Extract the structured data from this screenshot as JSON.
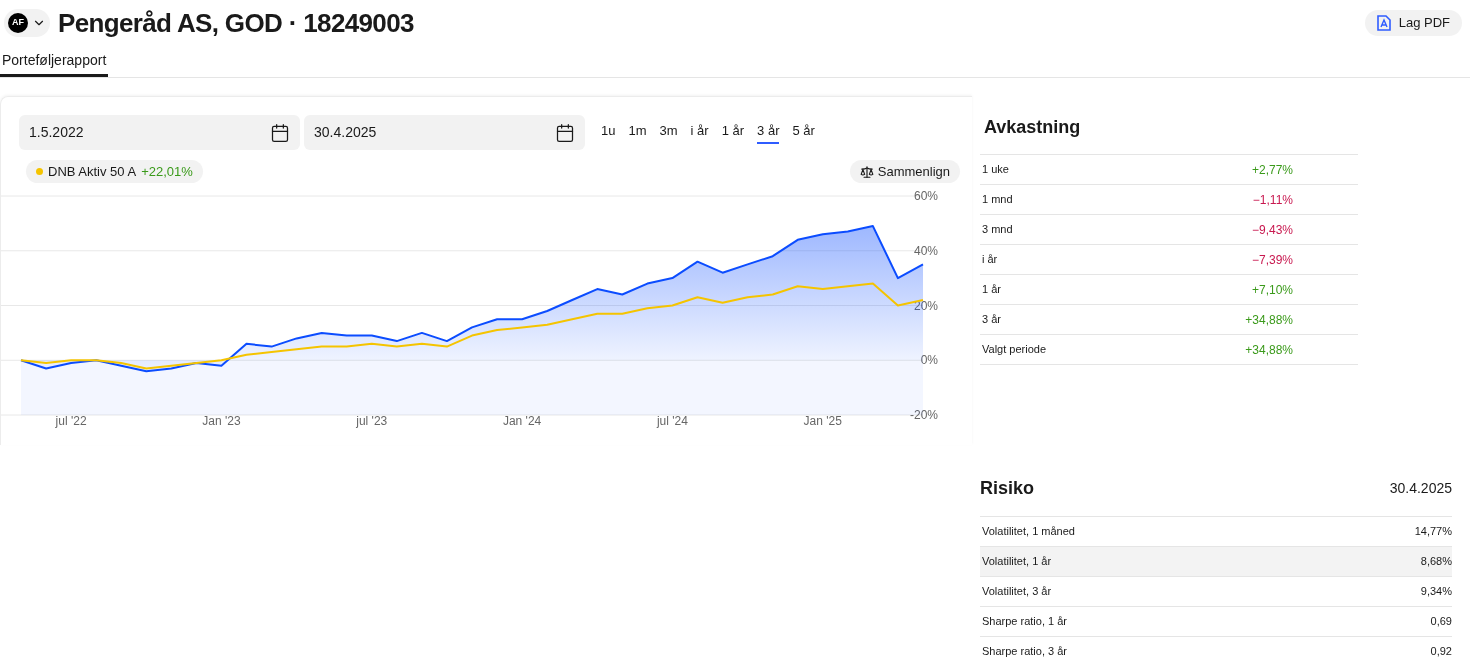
{
  "header": {
    "avatar": "AF",
    "title": "Pengeråd AS, GOD · 18249003",
    "pdf_button": "Lag PDF"
  },
  "tabs": [
    {
      "label": "Porteføljerapport",
      "selected": true
    }
  ],
  "date_range": {
    "from": "1.5.2022",
    "to": "30.4.2025"
  },
  "periods": [
    {
      "label": "1u",
      "selected": false
    },
    {
      "label": "1m",
      "selected": false
    },
    {
      "label": "3m",
      "selected": false
    },
    {
      "label": "i år",
      "selected": false
    },
    {
      "label": "1 år",
      "selected": false
    },
    {
      "label": "3 år",
      "selected": true
    },
    {
      "label": "5 år",
      "selected": false
    }
  ],
  "legend": [
    {
      "name": "DNB Aktiv 50 A",
      "value": "+22,01%",
      "color": "#f5c400"
    }
  ],
  "compare_button": "Sammenlign",
  "chart_data": {
    "type": "line",
    "categories": [
      null,
      null,
      "jul '22",
      null,
      null,
      null,
      null,
      null,
      "Jan '23",
      null,
      null,
      null,
      null,
      null,
      "jul '23",
      null,
      null,
      null,
      null,
      null,
      "Jan '24",
      null,
      null,
      null,
      null,
      null,
      "jul '24",
      null,
      null,
      null,
      null,
      null,
      "Jan '25",
      null,
      null,
      null,
      null
    ],
    "series": [
      {
        "type": "area",
        "color": "#0b4cff",
        "values": [
          0,
          -3,
          -1,
          0,
          -2,
          -4,
          -3,
          -1,
          -2,
          6,
          5,
          8,
          10,
          9,
          9,
          7,
          10,
          7,
          12,
          15,
          15,
          18,
          22,
          26,
          24,
          28,
          30,
          36,
          32,
          35,
          38,
          44,
          46,
          47,
          49,
          30,
          35
        ]
      },
      {
        "type": "line",
        "color": "#f5c400",
        "values": [
          0,
          -1,
          0,
          0,
          -1,
          -3,
          -2,
          -1,
          0,
          2,
          3,
          4,
          5,
          5,
          6,
          5,
          6,
          5,
          9,
          11,
          12,
          13,
          15,
          17,
          17,
          19,
          20,
          23,
          21,
          23,
          24,
          27,
          26,
          27,
          28,
          20,
          22
        ]
      }
    ],
    "ylim": [
      -20,
      60
    ],
    "grid": true,
    "yticks": [
      {
        "value": 60,
        "label": "60%"
      },
      {
        "value": 40,
        "label": "40%"
      },
      {
        "value": 20,
        "label": "20%"
      },
      {
        "value": 0,
        "label": "0%"
      },
      {
        "value": -20,
        "label": "-20%"
      }
    ]
  },
  "returns": {
    "title": "Avkastning",
    "rows": [
      {
        "label": "1 uke",
        "value": "+2,77%",
        "color": "#3a9a1a"
      },
      {
        "label": "1 mnd",
        "value": "−1,11%",
        "color": "#c8184f"
      },
      {
        "label": "3 mnd",
        "value": "−9,43%",
        "color": "#c8184f"
      },
      {
        "label": "i år",
        "value": "−7,39%",
        "color": "#c8184f"
      },
      {
        "label": "1 år",
        "value": "+7,10%",
        "color": "#3a9a1a"
      },
      {
        "label": "3 år",
        "value": "+34,88%",
        "color": "#3a9a1a"
      },
      {
        "label": "Valgt periode",
        "value": "+34,88%",
        "color": "#3a9a1a"
      }
    ]
  },
  "risk": {
    "title": "Risiko",
    "date": "30.4.2025",
    "rows": [
      {
        "label": "Volatilitet, 1 måned",
        "value": "14,77%",
        "selected": false
      },
      {
        "label": "Volatilitet, 1 år",
        "value": "8,68%",
        "selected": true
      },
      {
        "label": "Volatilitet, 3 år",
        "value": "9,34%",
        "selected": false
      },
      {
        "label": "Sharpe ratio, 1 år",
        "value": "0,69",
        "selected": false
      },
      {
        "label": "Sharpe ratio, 3 år",
        "value": "0,92",
        "selected": false
      }
    ]
  }
}
